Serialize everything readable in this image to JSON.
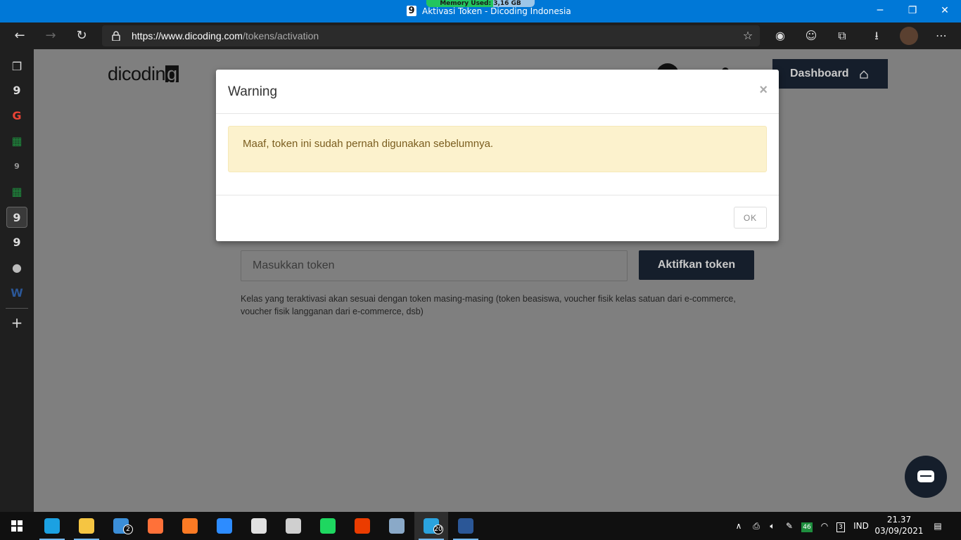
{
  "titlebar": {
    "memory_label": "Memory Used: 3,16 GB",
    "memory_fraction": 0.62,
    "tab_icon": "dicoding-g-icon",
    "page_title": "Aktivasi Token - Dicoding Indonesia",
    "controls": [
      "minimize-icon",
      "restore-icon",
      "close-icon"
    ]
  },
  "browser": {
    "url_domain": "https://www.dicoding.com",
    "url_path": "/tokens/activation",
    "nav_icons": [
      "back-icon",
      "forward-icon",
      "refresh-icon"
    ],
    "toolbar_icons": [
      "favorites-star-icon",
      "extension-icon",
      "extension-face-icon",
      "extensions-puzzle-icon",
      "downloads-icon",
      "profile-avatar-icon",
      "more-menu-icon"
    ]
  },
  "sidebar": {
    "items": [
      {
        "icon": "tab-actions-icon",
        "glyph": "❐"
      },
      {
        "icon": "dicoding-tab-icon",
        "glyph": "9"
      },
      {
        "icon": "google-tab-icon",
        "glyph": "G"
      },
      {
        "icon": "sheets-tab-icon",
        "glyph": "▦"
      },
      {
        "icon": "dicoding-tab-icon",
        "glyph": "9"
      },
      {
        "icon": "sheets-tab-icon",
        "glyph": "▦"
      },
      {
        "icon": "dicoding-tab-icon",
        "glyph": "9"
      },
      {
        "icon": "dicoding-tab-icon",
        "glyph": "9"
      },
      {
        "icon": "github-tab-icon",
        "glyph": "●"
      },
      {
        "icon": "word-tab-icon",
        "glyph": "W"
      },
      {
        "icon": "new-tab-icon",
        "glyph": "+"
      }
    ]
  },
  "page": {
    "logo": "dicodin",
    "logo_g": "g",
    "dashboard_label": "Dashboard",
    "token_placeholder": "Masukkan token",
    "activate_label": "Aktifkan token",
    "help_text": "Kelas yang teraktivasi akan sesuai dengan token masing-masing (token beasiswa, voucher fisik kelas satuan dari e-commerce, voucher fisik langganan dari e-commerce, dsb)"
  },
  "modal": {
    "title": "Warning",
    "close": "×",
    "message": "Maaf, token ini sudah pernah digunakan sebelumnya.",
    "ok_label": "OK"
  },
  "taskbar": {
    "apps": [
      {
        "name": "edge-icon",
        "color": "#1ba1e2"
      },
      {
        "name": "file-explorer-icon",
        "color": "#f5c542"
      },
      {
        "name": "mail-icon",
        "color": "#3b8ed8",
        "badge": "2"
      },
      {
        "name": "firefox-icon",
        "color": "#ff7139"
      },
      {
        "name": "xampp-icon",
        "color": "#fb7a24"
      },
      {
        "name": "zoom-icon",
        "color": "#2d8cff"
      },
      {
        "name": "paint-icon",
        "color": "#e0e0e0"
      },
      {
        "name": "keyboard-icon",
        "color": "#cfcfcf"
      },
      {
        "name": "media-icon",
        "color": "#1ed760"
      },
      {
        "name": "office-icon",
        "color": "#eb3c00"
      },
      {
        "name": "photos-icon",
        "color": "#8aa9c8"
      },
      {
        "name": "telegram-icon",
        "color": "#2aa3df",
        "badge": "20"
      },
      {
        "name": "word-icon",
        "color": "#2b5797"
      }
    ],
    "tray": {
      "battery_level": "46",
      "notification_count": "3",
      "language": "IND",
      "time": "21.37",
      "date": "03/09/2021"
    }
  }
}
